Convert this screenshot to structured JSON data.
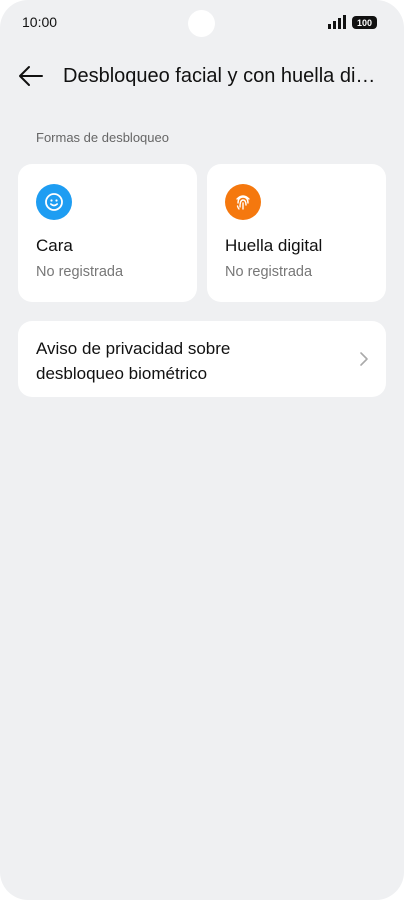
{
  "status_bar": {
    "time": "10:00",
    "battery": "100",
    "icons": [
      "signal-icon",
      "battery-icon"
    ]
  },
  "header": {
    "back_icon": "back-arrow-icon",
    "title": "Desbloqueo facial y con huella digital"
  },
  "section": {
    "label": "Formas de desbloqueo"
  },
  "unlock_methods": [
    {
      "title": "Cara",
      "subtitle": "No registrada",
      "icon": "face-icon",
      "color": "#1e9df2"
    },
    {
      "title": "Huella digital",
      "subtitle": "No registrada",
      "icon": "fingerprint-icon",
      "color": "#f5780e"
    }
  ],
  "privacy": {
    "line1": "Aviso de privacidad sobre",
    "line2": "desbloqueo biométrico",
    "icon": "chevron-right-icon"
  },
  "colors": {
    "background": "#eff0f2",
    "card": "#ffffff",
    "accent_blue": "#1e9df2",
    "accent_orange": "#f5780e"
  }
}
